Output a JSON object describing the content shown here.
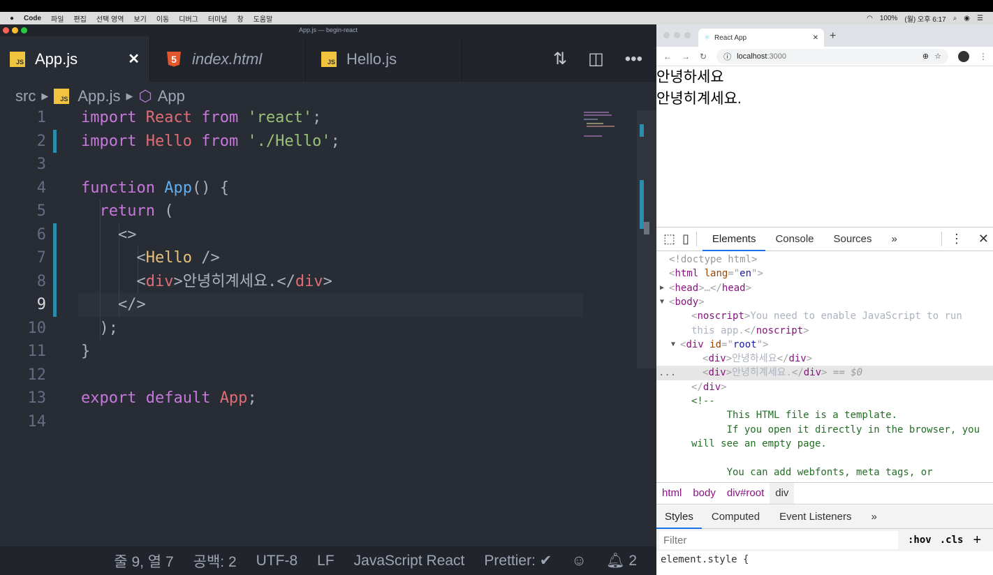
{
  "menubar": {
    "app": "Code",
    "items": [
      "파일",
      "편집",
      "선택 영역",
      "보기",
      "이동",
      "디버그",
      "터미널",
      "창",
      "도움말"
    ],
    "battery": "100%",
    "clock": "(월) 오후 6:17"
  },
  "editor": {
    "window_title": "App.js — begin-react",
    "tabs": [
      {
        "label": "App.js",
        "icon": "js-file-icon",
        "active": true
      },
      {
        "label": "index.html",
        "icon": "html5-file-icon"
      },
      {
        "label": "Hello.js",
        "icon": "js-file-icon"
      }
    ],
    "breadcrumb": [
      "src",
      "App.js",
      "App"
    ],
    "code_lines": [
      [
        [
          "k",
          "import "
        ],
        [
          "v",
          "React "
        ],
        [
          "k",
          "from "
        ],
        [
          "s",
          "'react'"
        ],
        [
          "p",
          ";"
        ]
      ],
      [
        [
          "k",
          "import "
        ],
        [
          "v",
          "Hello "
        ],
        [
          "k",
          "from "
        ],
        [
          "s",
          "'./Hello'"
        ],
        [
          "p",
          ";"
        ]
      ],
      [],
      [
        [
          "k",
          "function "
        ],
        [
          "f",
          "App"
        ],
        [
          "p",
          "() {"
        ]
      ],
      [
        [
          "p",
          "  "
        ],
        [
          "k",
          "return "
        ],
        [
          "p",
          "("
        ]
      ],
      [
        [
          "p",
          "    <>"
        ]
      ],
      [
        [
          "p",
          "      <"
        ],
        [
          "c",
          "Hello"
        ],
        [
          "p",
          " />"
        ]
      ],
      [
        [
          "p",
          "      <"
        ],
        [
          "v",
          "div"
        ],
        [
          "p",
          ">안녕히계세요.</"
        ],
        [
          "v",
          "div"
        ],
        [
          "p",
          ">"
        ]
      ],
      [
        [
          "p",
          "    </>"
        ]
      ],
      [
        [
          "p",
          "  );"
        ]
      ],
      [
        [
          "p",
          "}"
        ]
      ],
      [],
      [
        [
          "k",
          "export "
        ],
        [
          "k",
          "default "
        ],
        [
          "v",
          "App"
        ],
        [
          "p",
          ";"
        ]
      ],
      []
    ],
    "current_line": 9,
    "modified_lines": [
      2,
      6,
      7,
      8,
      9
    ],
    "status": {
      "position": "줄 9, 열 7",
      "spaces": "공백: 2",
      "encoding": "UTF-8",
      "eol": "LF",
      "language": "JavaScript React",
      "prettier": "Prettier: ✔",
      "notifications": "2"
    }
  },
  "browser": {
    "tab_title": "React App",
    "url_host": "localhost",
    "url_port": ":3000",
    "page_lines": [
      "안녕하세요",
      "안녕히계세요."
    ],
    "devtools": {
      "tabs": [
        "Elements",
        "Console",
        "Sources",
        "»"
      ],
      "active_tab": "Elements",
      "tree": [
        {
          "indent": 0,
          "parts": [
            [
              "dt",
              "<!doctype html>"
            ]
          ]
        },
        {
          "indent": 0,
          "parts": [
            [
              "br",
              "<"
            ],
            [
              "tg",
              "html "
            ],
            [
              "at",
              "lang"
            ],
            [
              "br",
              "=\""
            ],
            [
              "av",
              "en"
            ],
            [
              "br",
              "\">"
            ]
          ]
        },
        {
          "indent": 0,
          "arrow": "▶",
          "parts": [
            [
              "br",
              "<"
            ],
            [
              "tg",
              "head"
            ],
            [
              "br",
              ">"
            ],
            [
              "p",
              "…"
            ],
            [
              "br",
              "</"
            ],
            [
              "tg",
              "head"
            ],
            [
              "br",
              ">"
            ]
          ]
        },
        {
          "indent": 0,
          "arrow": "▼",
          "parts": [
            [
              "br",
              "<"
            ],
            [
              "tg",
              "body"
            ],
            [
              "br",
              ">"
            ]
          ]
        },
        {
          "indent": 2,
          "parts": [
            [
              "br",
              "<"
            ],
            [
              "tg",
              "noscript"
            ],
            [
              "br",
              ">"
            ],
            [
              "p",
              "You need to enable JavaScript to run"
            ]
          ]
        },
        {
          "indent": 2,
          "parts": [
            [
              "p",
              "this app."
            ],
            [
              "br",
              "</"
            ],
            [
              "tg",
              "noscript"
            ],
            [
              "br",
              ">"
            ]
          ]
        },
        {
          "indent": 1,
          "arrow": "▼",
          "parts": [
            [
              "br",
              "<"
            ],
            [
              "tg",
              "div "
            ],
            [
              "at",
              "id"
            ],
            [
              "br",
              "=\""
            ],
            [
              "av",
              "root"
            ],
            [
              "br",
              "\">"
            ]
          ]
        },
        {
          "indent": 3,
          "parts": [
            [
              "br",
              "<"
            ],
            [
              "tg",
              "div"
            ],
            [
              "br",
              ">"
            ],
            [
              "p",
              "안녕하세요"
            ],
            [
              "br",
              "</"
            ],
            [
              "tg",
              "div"
            ],
            [
              "br",
              ">"
            ]
          ]
        },
        {
          "indent": 3,
          "selected": true,
          "parts": [
            [
              "br",
              "<"
            ],
            [
              "tg",
              "div"
            ],
            [
              "br",
              ">"
            ],
            [
              "p",
              "안녕히계세요."
            ],
            [
              "br",
              "</"
            ],
            [
              "tg",
              "div"
            ],
            [
              "br",
              ">"
            ],
            [
              "dt",
              " == $0"
            ]
          ]
        },
        {
          "indent": 2,
          "parts": [
            [
              "br",
              "</"
            ],
            [
              "tg",
              "div"
            ],
            [
              "br",
              ">"
            ]
          ]
        },
        {
          "indent": 2,
          "parts": [
            [
              "cm",
              "<!--"
            ]
          ]
        },
        {
          "indent": 2,
          "parts": [
            [
              "cm",
              "      This HTML file is a template."
            ]
          ]
        },
        {
          "indent": 2,
          "parts": [
            [
              "cm",
              "      If you open it directly in the browser, you"
            ]
          ]
        },
        {
          "indent": 2,
          "parts": [
            [
              "cm",
              "will see an empty page."
            ]
          ]
        },
        {
          "indent": 2,
          "parts": [
            [
              "cm",
              ""
            ]
          ]
        },
        {
          "indent": 2,
          "parts": [
            [
              "cm",
              "      You can add webfonts, meta tags, or"
            ]
          ]
        }
      ],
      "breadcrumb": [
        "html",
        "body",
        "div#root",
        "div"
      ],
      "style_tabs": [
        "Styles",
        "Computed",
        "Event Listeners",
        "»"
      ],
      "filter_placeholder": "Filter",
      "hov": ":hov",
      "cls": ".cls",
      "element_style": "element.style {"
    }
  }
}
